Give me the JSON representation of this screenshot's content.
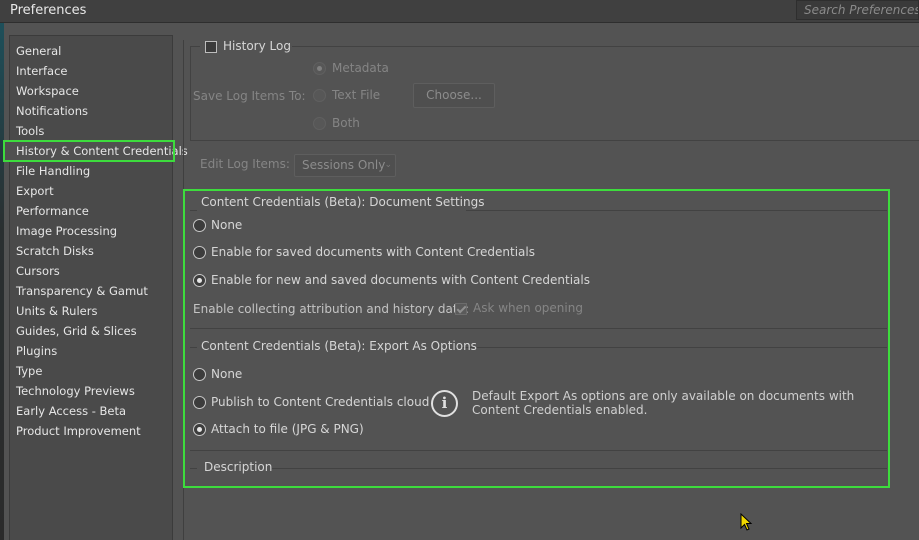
{
  "window": {
    "title": "Preferences",
    "search_placeholder": "Search Preferences"
  },
  "sidebar": {
    "items": [
      {
        "label": "General"
      },
      {
        "label": "Interface"
      },
      {
        "label": "Workspace"
      },
      {
        "label": "Notifications"
      },
      {
        "label": "Tools"
      },
      {
        "label": "History & Content Credentials",
        "selected": true
      },
      {
        "label": "File Handling"
      },
      {
        "label": "Export"
      },
      {
        "label": "Performance"
      },
      {
        "label": "Image Processing"
      },
      {
        "label": "Scratch Disks"
      },
      {
        "label": "Cursors"
      },
      {
        "label": "Transparency & Gamut"
      },
      {
        "label": "Units & Rulers"
      },
      {
        "label": "Guides, Grid & Slices"
      },
      {
        "label": "Plugins"
      },
      {
        "label": "Type"
      },
      {
        "label": "Technology Previews"
      },
      {
        "label": "Early Access - Beta"
      },
      {
        "label": "Product Improvement"
      }
    ]
  },
  "history_log": {
    "checkbox_label": "History Log",
    "checked": false,
    "save_log_label": "Save Log Items To:",
    "options": [
      "Metadata",
      "Text File",
      "Both"
    ],
    "selected_option": "Metadata",
    "choose_button": "Choose...",
    "edit_log_label": "Edit Log Items:",
    "edit_log_value": "Sessions Only"
  },
  "document_settings": {
    "title": "Content Credentials (Beta): Document Settings",
    "options": [
      "None",
      "Enable for saved documents with Content Credentials",
      "Enable for new and saved documents with Content Credentials"
    ],
    "selected_option": "Enable for new and saved documents with Content Credentials",
    "collect_label": "Enable collecting attribution and history data:",
    "ask_label": "Ask when opening",
    "ask_checked": true
  },
  "export_options": {
    "title": "Content Credentials (Beta): Export As Options",
    "options": [
      "None",
      "Publish to Content Credentials cloud",
      "Attach to file (JPG & PNG)"
    ],
    "selected_option": "Attach to file (JPG & PNG)",
    "info_icon": "info-circle-icon",
    "info_text": "Default Export As options are only available on documents with Content Credentials enabled."
  },
  "description": {
    "title": "Description"
  },
  "colors": {
    "highlight": "#3ddc3d",
    "background": "#535353"
  }
}
